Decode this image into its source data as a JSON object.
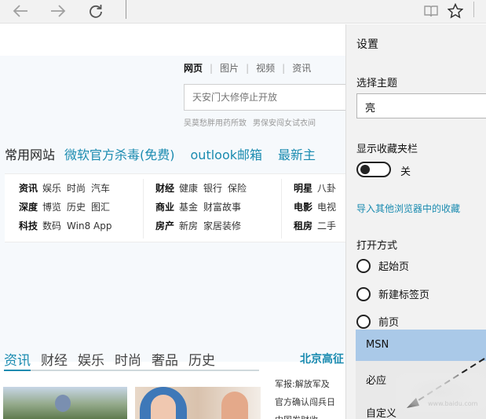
{
  "toolbar": {
    "back_icon": "arrow-left-icon",
    "forward_icon": "arrow-right-icon",
    "refresh_icon": "refresh-icon",
    "reading_icon": "book-icon",
    "favorite_icon": "star-icon"
  },
  "page": {
    "search_tabs": [
      "网页",
      "图片",
      "视频",
      "资讯"
    ],
    "search_placeholder": "天安门大修停止开放",
    "hot_words": [
      "吴莫愁胖用药所致",
      "男保安闯女试衣间"
    ],
    "common_sites_label": "常用网站",
    "common_sites": [
      "微软官方杀毒(免费)",
      "outlook邮箱",
      "最新主"
    ],
    "categories": {
      "col1": [
        {
          "head": "资讯",
          "items": [
            "娱乐",
            "时尚",
            "汽车"
          ]
        },
        {
          "head": "深度",
          "items": [
            "博览",
            "历史",
            "图汇"
          ]
        },
        {
          "head": "科技",
          "items": [
            "数码",
            "Win8 App"
          ]
        }
      ],
      "col2": [
        {
          "head": "财经",
          "items": [
            "健康",
            "银行",
            "保险"
          ]
        },
        {
          "head": "商业",
          "items": [
            "基金",
            "财富故事"
          ]
        },
        {
          "head": "房产",
          "items": [
            "新房",
            "家居装修"
          ]
        }
      ],
      "col3": [
        {
          "head": "明星",
          "items": [
            "八卦"
          ]
        },
        {
          "head": "电影",
          "items": [
            "电视"
          ]
        },
        {
          "head": "租房",
          "items": [
            "二手"
          ]
        }
      ]
    },
    "news_tabs": [
      "资讯",
      "财经",
      "娱乐",
      "时尚",
      "奢品",
      "历史"
    ],
    "city_title": "北京高征",
    "side_news": [
      "军报:解放军及",
      "官方确认闯兵日",
      "中国发财收"
    ]
  },
  "settings": {
    "title": "设置",
    "theme_label": "选择主题",
    "theme_value": "亮",
    "favorites_bar_label": "显示收藏夹栏",
    "favorites_bar_state": "关",
    "import_link": "导入其他浏览器中的收藏",
    "open_with_label": "打开方式",
    "open_options": [
      "起始页",
      "新建标签页",
      "前页"
    ],
    "dropdown_options": [
      "MSN",
      "必应",
      "自定义"
    ]
  },
  "watermark": "www.baidu.com"
}
